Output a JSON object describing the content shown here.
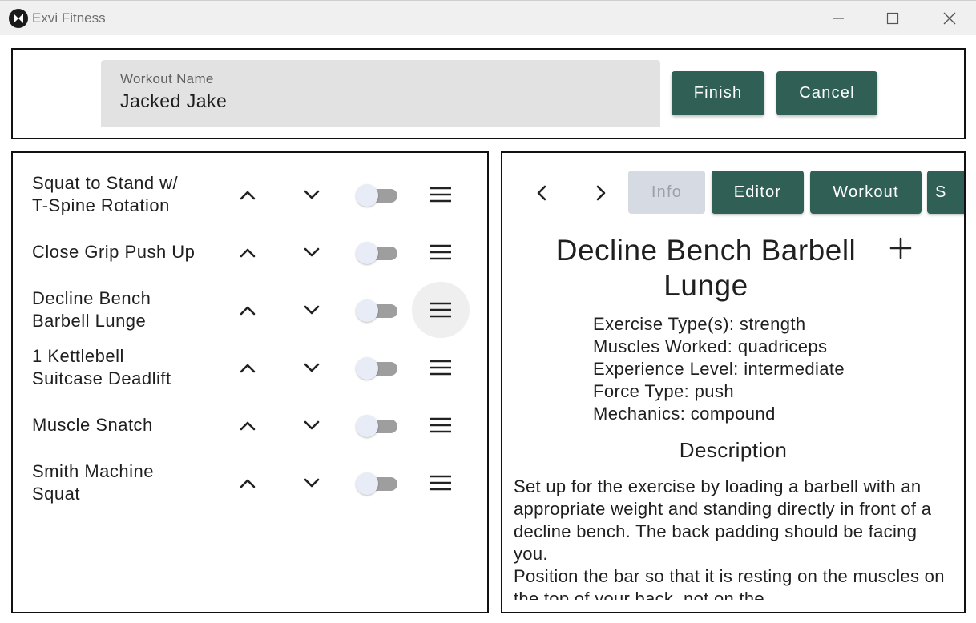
{
  "window": {
    "title": "Exvi Fitness"
  },
  "header": {
    "workout_name_label": "Workout Name",
    "workout_name_value": "Jacked Jake",
    "finish_label": "Finish",
    "cancel_label": "Cancel"
  },
  "exercises": [
    {
      "name": "Squat to Stand w/\nT-Spine Rotation",
      "toggle_on": false
    },
    {
      "name": "Close Grip Push Up",
      "toggle_on": false
    },
    {
      "name": "Decline Bench\nBarbell Lunge",
      "toggle_on": false,
      "hovered": true
    },
    {
      "name": "1 Kettlebell\nSuitcase Deadlift",
      "toggle_on": false
    },
    {
      "name": "Muscle Snatch",
      "toggle_on": false
    },
    {
      "name": "Smith Machine\nSquat",
      "toggle_on": false
    }
  ],
  "detail": {
    "tabs": [
      {
        "label": "Info",
        "state": "disabled"
      },
      {
        "label": "Editor",
        "state": "active"
      },
      {
        "label": "Workout",
        "state": "active"
      },
      {
        "label": "S",
        "state": "active"
      }
    ],
    "title": "Decline Bench Barbell Lunge",
    "meta": [
      "Exercise Type(s): strength",
      "Muscles Worked: quadriceps",
      "Experience Level: intermediate",
      "Force Type: push",
      "Mechanics: compound"
    ],
    "description_heading": "Description",
    "description_paragraphs": [
      "Set up for the exercise by loading a barbell with an appropriate weight and standing directly in front of a decline bench. The back padding should be facing you.",
      "Position the bar so that it is resting on the muscles on the top of your back, not on the"
    ]
  },
  "colors": {
    "primary": "#2f5f55",
    "disabled_bg": "#d6dbe3",
    "disabled_text": "#9aa1ab",
    "field_bg": "#e2e2e2",
    "titlebar_bg": "#f0f0f0"
  },
  "icons": {
    "app": "exvi-logo-icon",
    "minimize": "minimize-icon",
    "maximize": "maximize-icon",
    "close": "close-icon",
    "move_up": "chevron-up-icon",
    "move_down": "chevron-down-icon",
    "drag": "drag-handle-icon",
    "prev": "chevron-left-icon",
    "next": "chevron-right-icon",
    "add": "plus-icon"
  }
}
